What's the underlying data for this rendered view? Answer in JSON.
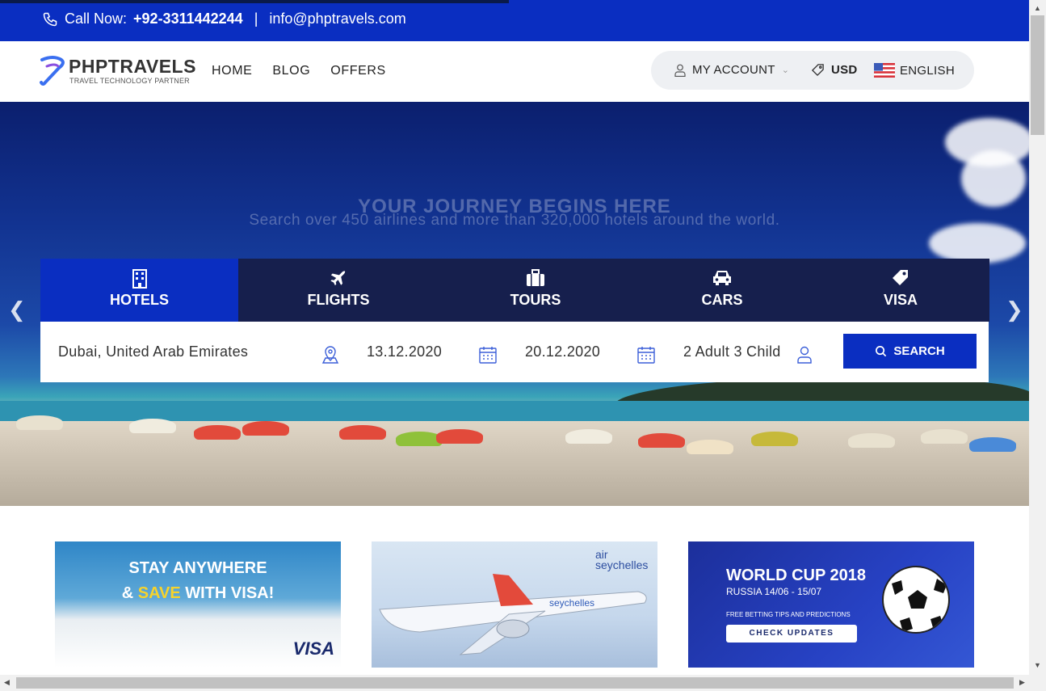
{
  "topbar": {
    "call_label": "Call Now:",
    "phone": "+92-3311442244",
    "separator": "|",
    "email": "info@phptravels.com"
  },
  "header": {
    "logo_text": "PHPTRAVELS",
    "logo_tagline": "TRAVEL TECHNOLOGY PARTNER",
    "nav": [
      "HOME",
      "BLOG",
      "OFFERS"
    ],
    "account_label": "MY ACCOUNT",
    "currency": "USD",
    "language": "ENGLISH"
  },
  "hero": {
    "title": "YOUR JOURNEY BEGINS HERE",
    "subtitle": "Search over 450 airlines and more than 320,000 hotels around the world."
  },
  "tabs": [
    {
      "label": "HOTELS",
      "icon": "building-icon",
      "active": true
    },
    {
      "label": "FLIGHTS",
      "icon": "plane-icon",
      "active": false
    },
    {
      "label": "TOURS",
      "icon": "suitcase-icon",
      "active": false
    },
    {
      "label": "CARS",
      "icon": "car-icon",
      "active": false
    },
    {
      "label": "VISA",
      "icon": "tag-icon",
      "active": false
    }
  ],
  "search": {
    "destination": "Dubai, United Arab Emirates",
    "checkin": "13.12.2020",
    "checkout": "20.12.2020",
    "guests": "2 Adult 3 Child",
    "button_label": "SEARCH"
  },
  "promos": {
    "card1": {
      "line1": "STAY ANYWHERE",
      "line2_a": "& ",
      "line2_b": "SAVE",
      "line2_c": " WITH VISA!",
      "brand": "VISA"
    },
    "card2": {
      "brand_a": "air",
      "brand_b": "seychelles"
    },
    "card3": {
      "title": "WORLD CUP 2018",
      "dates": "RUSSIA 14/06 - 15/07",
      "tagline": "FREE BETTING TIPS AND PREDICTIONS",
      "button": "CHECK UPDATES"
    }
  },
  "colors": {
    "primary": "#0a2ec1",
    "tab_bar": "#161f4d",
    "accent_yellow": "#f7d32b"
  }
}
